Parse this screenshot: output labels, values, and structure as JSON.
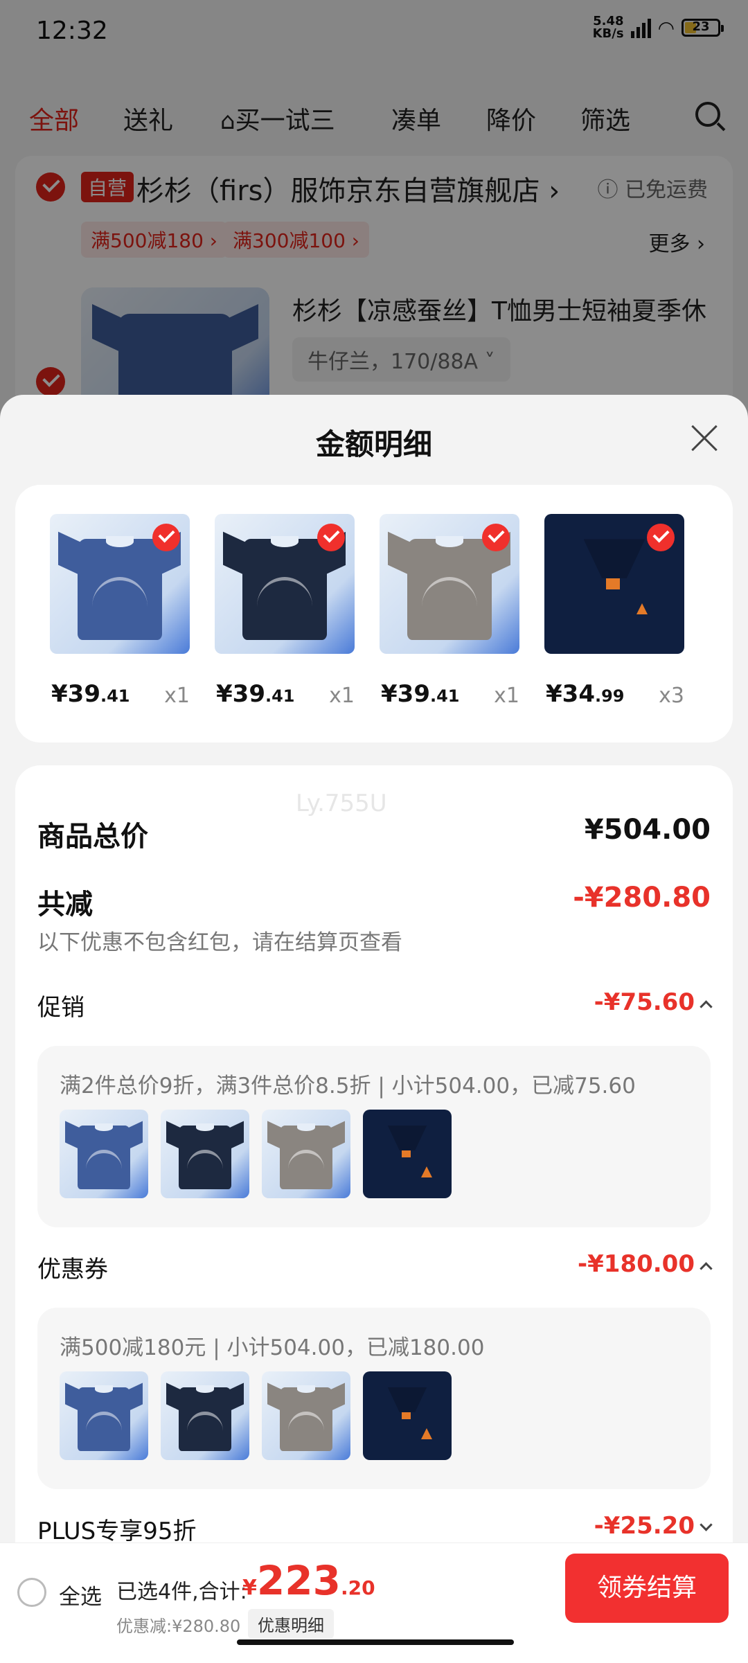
{
  "status_bar": {
    "time": "12:32",
    "net_speed": "5.48",
    "net_unit": "KB/s",
    "battery": "23"
  },
  "tabs": [
    "全部",
    "送礼",
    "买一试三",
    "凑单",
    "降价",
    "筛选"
  ],
  "store": {
    "self_tag": "自营",
    "name": "杉杉（firs）服饰京东自营旗舰店 ›",
    "free_shipping": "ⓘ 已免运费",
    "promos": [
      "满500减180 ›",
      "满300减100 ›"
    ],
    "more": "更多 ›",
    "product_title": "杉杉【凉感蚕丝】T恤男士短袖夏季休",
    "product_spec": "牛仔兰，170/88A ˅"
  },
  "sheet": {
    "title": "金额明细",
    "watermark": "Ly.755U",
    "items": [
      {
        "price_int": "¥39",
        "price_dec": ".41",
        "qty": "x1",
        "color": "#3f5d9c",
        "kind": "tee"
      },
      {
        "price_int": "¥39",
        "price_dec": ".41",
        "qty": "x1",
        "color": "#1d2940",
        "kind": "tee"
      },
      {
        "price_int": "¥39",
        "price_dec": ".41",
        "qty": "x1",
        "color": "#8a8580",
        "kind": "tee"
      },
      {
        "price_int": "¥34",
        "price_dec": ".99",
        "qty": "x3",
        "color": "#0f1f40",
        "kind": "polo"
      }
    ],
    "total_label": "商品总价",
    "total_value": "¥504.00",
    "reduce_label": "共减",
    "reduce_value": "-¥280.80",
    "reduce_note": "以下优惠不包含红包，请在结算页查看",
    "promo_label": "促销",
    "promo_value": "-¥75.60",
    "promo_text": "满2件总价9折，满3件总价8.5折 | 小计504.00，已减75.60",
    "coupon_label": "优惠券",
    "coupon_value": "-¥180.00",
    "coupon_text": "满500减180元 | 小计504.00，已减180.00",
    "plus_label": "PLUS专享95折",
    "plus_value": "-¥25.20"
  },
  "bottom": {
    "select_all": "全选",
    "selected": "已选4件,合计:",
    "currency": "¥",
    "total_int": "223",
    "total_dec": ".20",
    "saved": "优惠减:¥280.80",
    "detail": "优惠明细",
    "checkout": "领券结算"
  },
  "colors": {
    "accent": "#e8322a",
    "brand": "#e2231a",
    "button": "#f23030"
  }
}
